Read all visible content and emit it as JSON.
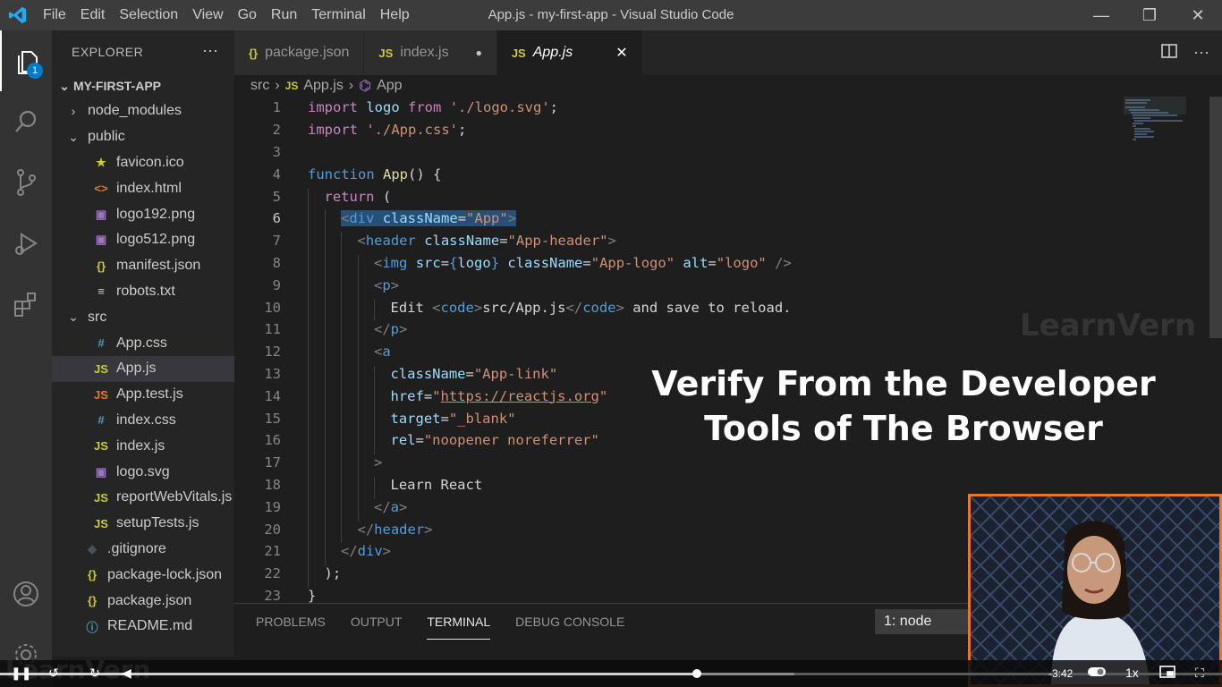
{
  "window": {
    "title": "App.js - my-first-app - Visual Studio Code",
    "minimize": "—",
    "maximize": "❐",
    "close": "✕"
  },
  "menu": [
    "File",
    "Edit",
    "Selection",
    "View",
    "Go",
    "Run",
    "Terminal",
    "Help"
  ],
  "activity": {
    "explorer_badge": "1"
  },
  "sidebar": {
    "header": "EXPLORER",
    "more": "···",
    "folder": "MY-FIRST-APP",
    "items": [
      {
        "label": "node_modules",
        "twisty": "›",
        "icon": "",
        "color": "#c5c5c5"
      },
      {
        "label": "public",
        "twisty": "⌄",
        "icon": "",
        "color": "#c5c5c5"
      },
      {
        "label": "favicon.ico",
        "twisty": "",
        "icon": "★",
        "color": "#cbcb41"
      },
      {
        "label": "index.html",
        "twisty": "",
        "icon": "<>",
        "color": "#e37933"
      },
      {
        "label": "logo192.png",
        "twisty": "",
        "icon": "▣",
        "color": "#a074c4"
      },
      {
        "label": "logo512.png",
        "twisty": "",
        "icon": "▣",
        "color": "#a074c4"
      },
      {
        "label": "manifest.json",
        "twisty": "",
        "icon": "{}",
        "color": "#cbcb41"
      },
      {
        "label": "robots.txt",
        "twisty": "",
        "icon": "≡",
        "color": "#cccccc"
      },
      {
        "label": "src",
        "twisty": "⌄",
        "icon": "",
        "color": "#c5c5c5"
      },
      {
        "label": "App.css",
        "twisty": "",
        "icon": "#",
        "color": "#519aba"
      },
      {
        "label": "App.js",
        "twisty": "",
        "icon": "JS",
        "color": "#cbcb41"
      },
      {
        "label": "App.test.js",
        "twisty": "",
        "icon": "JS",
        "color": "#e37933"
      },
      {
        "label": "index.css",
        "twisty": "",
        "icon": "#",
        "color": "#519aba"
      },
      {
        "label": "index.js",
        "twisty": "",
        "icon": "JS",
        "color": "#cbcb41"
      },
      {
        "label": "logo.svg",
        "twisty": "",
        "icon": "▣",
        "color": "#a074c4"
      },
      {
        "label": "reportWebVitals.js",
        "twisty": "",
        "icon": "JS",
        "color": "#cbcb41"
      },
      {
        "label": "setupTests.js",
        "twisty": "",
        "icon": "JS",
        "color": "#cbcb41"
      },
      {
        "label": ".gitignore",
        "twisty": "",
        "icon": "◆",
        "color": "#41535b"
      },
      {
        "label": "package-lock.json",
        "twisty": "",
        "icon": "{}",
        "color": "#cbcb41"
      },
      {
        "label": "package.json",
        "twisty": "",
        "icon": "{}",
        "color": "#cbcb41"
      },
      {
        "label": "README.md",
        "twisty": "",
        "icon": "ⓘ",
        "color": "#519aba"
      }
    ]
  },
  "tabs": [
    {
      "label": "package.json",
      "icon": "{}",
      "icon_color": "#cbcb41"
    },
    {
      "label": "index.js",
      "icon": "JS",
      "icon_color": "#cbcb41",
      "dirty": "●"
    },
    {
      "label": "App.js",
      "icon": "JS",
      "icon_color": "#cbcb41",
      "close": "✕"
    }
  ],
  "breadcrumb": {
    "folder": "src",
    "sep": "›",
    "file_icon": "JS",
    "file": "App.js",
    "symbol_icon": "⌬",
    "symbol": "App"
  },
  "code_lines": [
    {
      "n": "1",
      "indent": 0,
      "html": "<span class='kc'>import</span> <span class='v'>logo</span> <span class='kc'>from</span> <span class='s'>'./logo.svg'</span><span class='w'>;</span>"
    },
    {
      "n": "2",
      "indent": 0,
      "html": "<span class='kc'>import</span> <span class='s'>'./App.css'</span><span class='w'>;</span>"
    },
    {
      "n": "3",
      "indent": 0,
      "html": ""
    },
    {
      "n": "4",
      "indent": 0,
      "html": "<span class='k'>function</span> <span class='f'>App</span><span class='w'>() {</span>"
    },
    {
      "n": "5",
      "indent": 1,
      "html": "<span class='kc'>return</span> <span class='w'>(</span>"
    },
    {
      "n": "6",
      "indent": 2,
      "html": "<span class='sel'><span class='g'>&lt;</span><span class='t'>div</span> <span class='v'>className</span><span class='w'>=</span><span class='s'>\"App\"</span><span class='g'>&gt;</span></span>"
    },
    {
      "n": "7",
      "indent": 3,
      "html": "<span class='g'>&lt;</span><span class='t'>header</span> <span class='v'>className</span><span class='w'>=</span><span class='s'>\"App-header\"</span><span class='g'>&gt;</span>"
    },
    {
      "n": "8",
      "indent": 4,
      "html": "<span class='g'>&lt;</span><span class='t'>img</span> <span class='v'>src</span><span class='w'>=</span><span class='k'>{</span><span class='v'>logo</span><span class='k'>}</span> <span class='v'>className</span><span class='w'>=</span><span class='s'>\"App-logo\"</span> <span class='v'>alt</span><span class='w'>=</span><span class='s'>\"logo\"</span> <span class='g'>/&gt;</span>"
    },
    {
      "n": "9",
      "indent": 4,
      "html": "<span class='g'>&lt;</span><span class='t'>p</span><span class='g'>&gt;</span>"
    },
    {
      "n": "10",
      "indent": 5,
      "html": "<span class='w'>Edit </span><span class='g'>&lt;</span><span class='t'>code</span><span class='g'>&gt;</span><span class='w'>src/App.js</span><span class='g'>&lt;/</span><span class='t'>code</span><span class='g'>&gt;</span><span class='w'> and save to reload.</span>"
    },
    {
      "n": "11",
      "indent": 4,
      "html": "<span class='g'>&lt;/</span><span class='t'>p</span><span class='g'>&gt;</span>"
    },
    {
      "n": "12",
      "indent": 4,
      "html": "<span class='g'>&lt;</span><span class='t'>a</span>"
    },
    {
      "n": "13",
      "indent": 5,
      "html": "<span class='v'>className</span><span class='w'>=</span><span class='s'>\"App-link\"</span>"
    },
    {
      "n": "14",
      "indent": 5,
      "html": "<span class='v'>href</span><span class='w'>=</span><span class='s'>\"<span class='u'>https://reactjs.org</span>\"</span>"
    },
    {
      "n": "15",
      "indent": 5,
      "html": "<span class='v'>target</span><span class='w'>=</span><span class='s'>\"_blank\"</span>"
    },
    {
      "n": "16",
      "indent": 5,
      "html": "<span class='v'>rel</span><span class='w'>=</span><span class='s'>\"noopener noreferrer\"</span>"
    },
    {
      "n": "17",
      "indent": 4,
      "html": "<span class='g'>&gt;</span>"
    },
    {
      "n": "18",
      "indent": 5,
      "html": "<span class='w'>Learn React</span>"
    },
    {
      "n": "19",
      "indent": 4,
      "html": "<span class='g'>&lt;/</span><span class='t'>a</span><span class='g'>&gt;</span>"
    },
    {
      "n": "20",
      "indent": 3,
      "html": "<span class='g'>&lt;/</span><span class='t'>header</span><span class='g'>&gt;</span>"
    },
    {
      "n": "21",
      "indent": 2,
      "html": "<span class='g'>&lt;/</span><span class='t'>div</span><span class='g'>&gt;</span>"
    },
    {
      "n": "22",
      "indent": 1,
      "html": "<span class='w'>);</span>"
    },
    {
      "n": "23",
      "indent": 0,
      "html": "<span class='w'>}</span>"
    }
  ],
  "current_line": "6",
  "overlay": {
    "line1": "Verify From the Developer",
    "line2": "Tools of The Browser"
  },
  "watermark": "LearnVern",
  "panel": {
    "tabs": [
      "PROBLEMS",
      "OUTPUT",
      "TERMINAL",
      "DEBUG CONSOLE"
    ],
    "active": "TERMINAL",
    "terminal_select": "1: node"
  },
  "player": {
    "brand": "LearnVern",
    "time_remaining": "-3:42",
    "speed": "1x",
    "progress": 0.57,
    "buffered": 0.65,
    "play_icon": "❚❚",
    "rewind_icon": "↺",
    "forward_icon": "↻",
    "volume_icon": "◀",
    "fullscreen_icon": "⛶"
  },
  "colors": {
    "accent": "#007acc",
    "presenter_border": "#e8772e"
  }
}
